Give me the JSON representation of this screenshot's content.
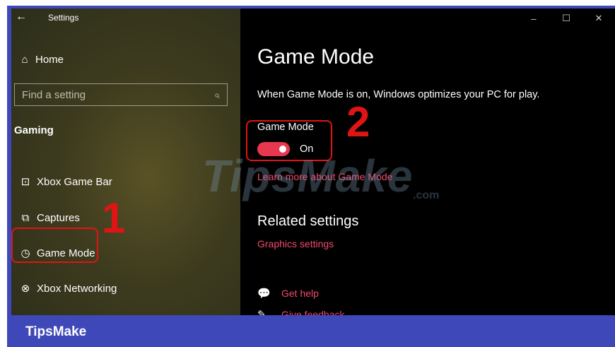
{
  "window": {
    "title": "Settings",
    "back_icon": "back-arrow-icon",
    "controls": {
      "minimize": "–",
      "maximize": "☐",
      "close": "✕"
    }
  },
  "sidebar": {
    "home_label": "Home",
    "search_placeholder": "Find a setting",
    "section_title": "Gaming",
    "items": [
      {
        "label": "Xbox Game Bar",
        "icon": "xbox-game-bar-icon"
      },
      {
        "label": "Captures",
        "icon": "captures-icon"
      },
      {
        "label": "Game Mode",
        "icon": "game-mode-icon"
      },
      {
        "label": "Xbox Networking",
        "icon": "xbox-icon"
      }
    ]
  },
  "main": {
    "title": "Game Mode",
    "description": "When Game Mode is on, Windows optimizes your PC for play.",
    "toggle_label": "Game Mode",
    "toggle_state": "On",
    "learn_more_link": "Learn more about Game Mode",
    "related_title": "Related settings",
    "graphics_link": "Graphics settings",
    "get_help": "Get help",
    "give_feedback": "Give feedback"
  },
  "annotations": {
    "step1": "1",
    "step2": "2"
  },
  "watermark": {
    "main": "TipsMake",
    "suffix": ".com"
  },
  "footer": {
    "brand": "TipsMake"
  },
  "colors": {
    "accent": "#e8384f",
    "link": "#f04a6a",
    "callout": "#e01414",
    "frame": "#3f48b8"
  }
}
